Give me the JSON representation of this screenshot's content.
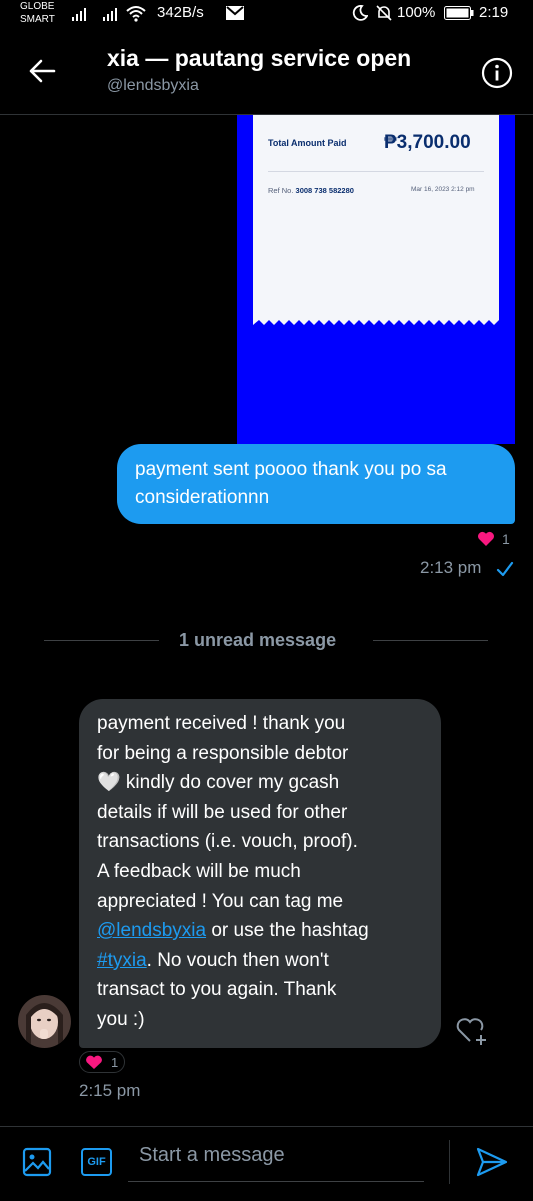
{
  "status_bar": {
    "carrier_top": "GLOBE",
    "carrier_bottom": "SMART",
    "speed": "342B/s",
    "battery": "100%",
    "clock": "2:19"
  },
  "header": {
    "title": "xia — pautang service open",
    "handle": "@lendsbyxia"
  },
  "receipt": {
    "total_label": "Total Amount Paid",
    "total_value": "₱3,700.00",
    "ref_label": "Ref No.",
    "ref_value": "3008 738 582280",
    "date": "Mar 16, 2023 2:12 pm"
  },
  "outgoing": {
    "text": "payment sent poooo thank you po sa considerationnn",
    "reaction_count": "1",
    "time": "2:13 pm"
  },
  "divider": {
    "label": "1 unread message"
  },
  "incoming": {
    "line1": "payment received !  thank you",
    "line2": "for being a responsible debtor",
    "line3": "🤍 kindly do cover my gcash",
    "line4": "details if will be used for other",
    "line5": "transactions (i.e. vouch, proof).",
    "line6": "A feedback will be much",
    "line7": "appreciated ! You can tag me",
    "mention": "@lendsbyxia",
    "line8_rest": " or use the hashtag",
    "hashtag": "#tyxia",
    "line9_rest": ". No vouch then won't",
    "line10": "transact to you again. Thank",
    "line11": "you :)",
    "reaction_count": "1",
    "time": "2:15 pm"
  },
  "composer": {
    "placeholder": "Start a message",
    "gif_label": "GIF"
  },
  "colors": {
    "accent": "#1d9bf0",
    "heart": "#f91880",
    "receipt_blue": "#0000ff",
    "incoming_bubble": "#2f3336"
  }
}
